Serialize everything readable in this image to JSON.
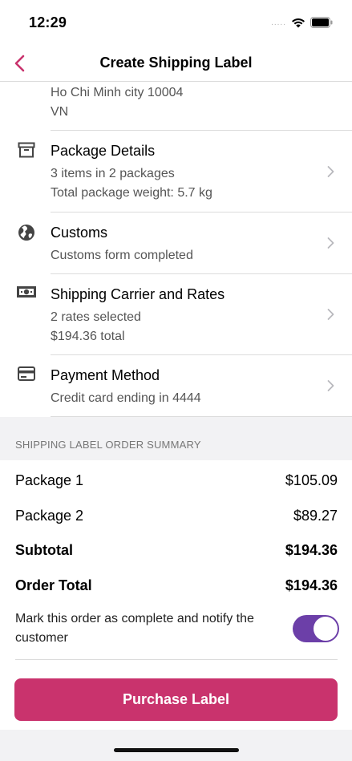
{
  "status": {
    "time": "12:29",
    "signal": "....."
  },
  "nav": {
    "title": "Create Shipping Label"
  },
  "address": {
    "lines": [
      "Ho Chi Minh city 10004",
      "VN"
    ]
  },
  "rows": [
    {
      "title": "Package Details",
      "lines": [
        "3 items in 2 packages",
        "Total package weight: 5.7 kg"
      ],
      "icon": "archive-box-icon"
    },
    {
      "title": "Customs",
      "lines": [
        "Customs form completed"
      ],
      "icon": "globe-icon"
    },
    {
      "title": "Shipping Carrier and Rates",
      "lines": [
        "2 rates selected",
        "$194.36 total"
      ],
      "icon": "money-icon"
    },
    {
      "title": "Payment Method",
      "lines": [
        "Credit card ending in 4444"
      ],
      "icon": "credit-card-icon"
    }
  ],
  "summary": {
    "header": "SHIPPING LABEL ORDER SUMMARY",
    "items": [
      {
        "label": "Package 1",
        "value": "$105.09"
      },
      {
        "label": "Package 2",
        "value": "$89.27"
      }
    ],
    "subtotal": {
      "label": "Subtotal",
      "value": "$194.36"
    },
    "total": {
      "label": "Order Total",
      "value": "$194.36"
    },
    "notify": {
      "label": "Mark this order as complete and notify the customer",
      "enabled": true
    }
  },
  "actions": {
    "purchase_label": "Purchase Label"
  },
  "colors": {
    "accent": "#c9336d",
    "toggle": "#6c3fa8"
  }
}
